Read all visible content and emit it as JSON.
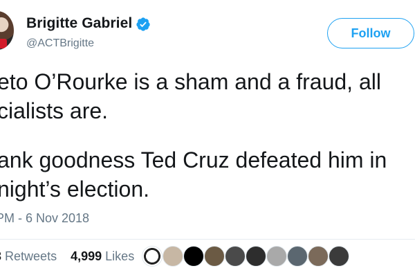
{
  "tweet": {
    "author_name": "Brigitte Gabriel",
    "author_handle": "@ACTBrigitte",
    "follow_label": "Follow",
    "lines": [
      "eto O’Rourke is a sham and a fraud, all",
      "cialists are.",
      "ank goodness Ted Cruz defeated him in",
      "night’s election."
    ],
    "timestamp": "PM - 6 Nov 2018",
    "retweets_count": "3",
    "retweets_label": "Retweets",
    "likes_count": "4,999",
    "likes_label": "Likes"
  },
  "icons": {
    "avatar": "user-avatar",
    "verified": "verified-badge-icon"
  },
  "likers": [
    {
      "icon": "liker-avatar-1",
      "color": "#ffffff"
    },
    {
      "icon": "liker-avatar-2",
      "color": "#c7b7a4"
    },
    {
      "icon": "liker-avatar-3",
      "color": "#000000"
    },
    {
      "icon": "liker-avatar-4",
      "color": "#6b5a44"
    },
    {
      "icon": "liker-avatar-5",
      "color": "#4a4a4a"
    },
    {
      "icon": "liker-avatar-6",
      "color": "#2d2d2d"
    },
    {
      "icon": "liker-avatar-7",
      "color": "#a9a9a9"
    },
    {
      "icon": "liker-avatar-8",
      "color": "#5b6770"
    },
    {
      "icon": "liker-avatar-9",
      "color": "#7b6a5a"
    },
    {
      "icon": "liker-avatar-10",
      "color": "#3b3b3b"
    }
  ],
  "colors": {
    "accent": "#1da1f2",
    "text": "#14171a",
    "muted": "#657786"
  }
}
